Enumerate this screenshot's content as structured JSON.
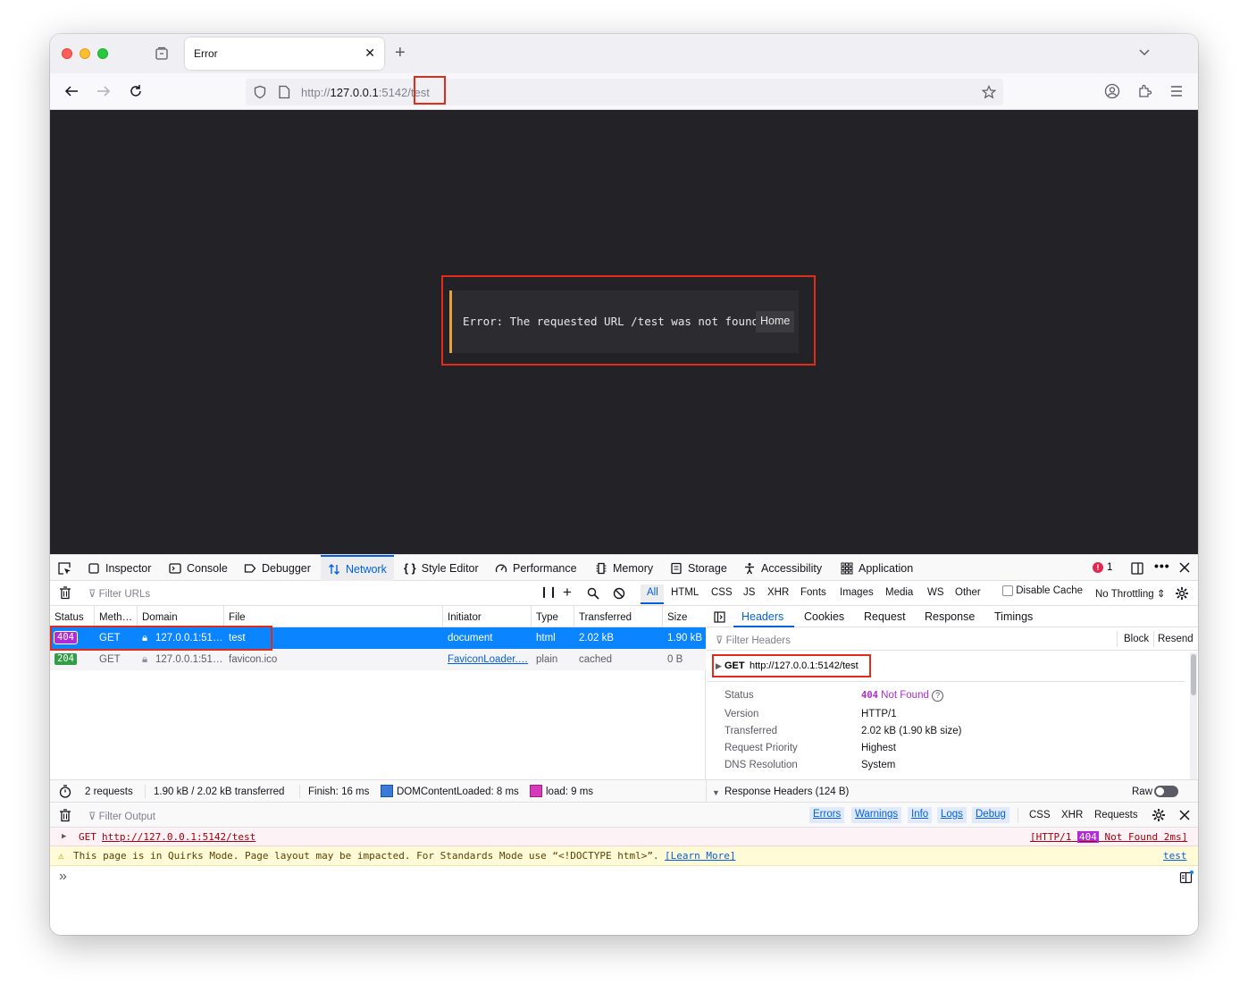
{
  "browser": {
    "tab_title": "Error",
    "tab_close": "✕",
    "new_tab": "+",
    "url_scheme": "http://",
    "url_host": "127.0.0.1",
    "url_port": ":5142",
    "url_path": "/test"
  },
  "page": {
    "error_message": "Error: The requested URL /test was not found",
    "home_link": "Home"
  },
  "devtools": {
    "tabs": [
      "Inspector",
      "Console",
      "Debugger",
      "Network",
      "Style Editor",
      "Performance",
      "Memory",
      "Storage",
      "Accessibility",
      "Application"
    ],
    "active_tab": "Network",
    "error_count": "1",
    "filter_urls_placeholder": "Filter URLs",
    "type_filters": [
      "All",
      "HTML",
      "CSS",
      "JS",
      "XHR",
      "Fonts",
      "Images",
      "Media",
      "WS",
      "Other"
    ],
    "disable_cache": "Disable Cache",
    "throttling": "No Throttling",
    "columns": [
      "Status",
      "Meth…",
      "Domain",
      "File",
      "Initiator",
      "Type",
      "Transferred",
      "Size"
    ],
    "requests": [
      {
        "status": "404",
        "status_color": "#b22bd4",
        "method": "GET",
        "domain": "127.0.0.1:51…",
        "file": "test",
        "initiator": "document",
        "type": "html",
        "transferred": "2.02 kB",
        "size": "1.90 kB"
      },
      {
        "status": "204",
        "status_color": "#2f9e44",
        "method": "GET",
        "domain": "127.0.0.1:51…",
        "file": "favicon.ico",
        "initiator": "FaviconLoader.…",
        "type": "plain",
        "transferred": "cached",
        "size": "0 B"
      }
    ],
    "detail_tabs": [
      "Headers",
      "Cookies",
      "Request",
      "Response",
      "Timings"
    ],
    "filter_headers_placeholder": "Filter Headers",
    "block": "Block",
    "resend": "Resend",
    "get_method": "GET",
    "get_url": "http://127.0.0.1:5142/test",
    "headers": {
      "status_label": "Status",
      "status_code": "404",
      "status_text": "Not Found",
      "version_label": "Version",
      "version": "HTTP/1",
      "transferred_label": "Transferred",
      "transferred": "2.02 kB (1.90 kB size)",
      "priority_label": "Request Priority",
      "priority": "Highest",
      "dns_label": "DNS Resolution",
      "dns": "System",
      "response_headers": "Response Headers (124 B)",
      "raw": "Raw"
    },
    "summary": {
      "requests": "2 requests",
      "transferred": "1.90 kB / 2.02 kB transferred",
      "finish": "Finish: 16 ms",
      "dom_content_loaded": "DOMContentLoaded: 8 ms",
      "load": "load: 9 ms"
    },
    "console": {
      "filter_output_placeholder": "Filter Output",
      "levels": [
        "Errors",
        "Warnings",
        "Info",
        "Logs",
        "Debug"
      ],
      "extra_filters": [
        "CSS",
        "XHR",
        "Requests"
      ],
      "error_prefix": "GET",
      "error_url": "http://127.0.0.1:5142/test",
      "error_meta_start": "[HTTP/1",
      "error_meta_code": "404",
      "error_meta_end": "Not Found 2ms]",
      "warning_text": "This page is in Quirks Mode. Page layout may be impacted. For Standards Mode use “<!DOCTYPE html>”.",
      "learn_more": "[Learn More]",
      "warning_source": "test",
      "prompt": "»"
    }
  }
}
